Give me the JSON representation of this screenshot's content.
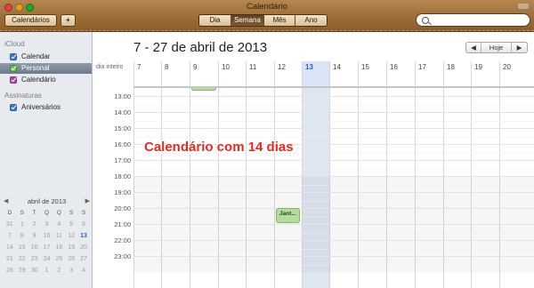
{
  "window": {
    "title": "Calendário"
  },
  "toolbar": {
    "calendars_label": "Calendários",
    "add_label": "+",
    "views": [
      "Dia",
      "Semana",
      "Mês",
      "Ano"
    ],
    "active_view": "Semana",
    "search_placeholder": ""
  },
  "sidebar": {
    "icloud_header": "iCloud",
    "icloud_items": [
      {
        "label": "Calendar",
        "color": "#3a78c6",
        "checked": true
      },
      {
        "label": "Personal",
        "color": "#6cbf4f",
        "checked": true,
        "selected": true
      },
      {
        "label": "Calendário",
        "color": "#b147a5",
        "checked": true
      }
    ],
    "subs_header": "Assinaturas",
    "subs_items": [
      {
        "label": "Aniversários",
        "color": "#3a78c6",
        "checked": true
      }
    ]
  },
  "mini_calendar": {
    "title": "abril de 2013",
    "prev": "◀",
    "next": "▶",
    "day_headers": [
      "D",
      "S",
      "T",
      "Q",
      "Q",
      "S",
      "S"
    ],
    "rows": [
      [
        "31",
        "1",
        "2",
        "3",
        "4",
        "5",
        "6"
      ],
      [
        "7",
        "8",
        "9",
        "10",
        "11",
        "12",
        "13"
      ],
      [
        "14",
        "15",
        "16",
        "17",
        "18",
        "19",
        "20"
      ],
      [
        "21",
        "22",
        "23",
        "24",
        "25",
        "26",
        "27"
      ],
      [
        "28",
        "29",
        "30",
        "1",
        "2",
        "3",
        "4"
      ]
    ],
    "today": "13"
  },
  "main": {
    "range_title": "7 - 27 de abril de 2013",
    "nav_prev": "◀",
    "nav_today": "Hoje",
    "nav_next": "▶",
    "allday_label": "dia inteiro",
    "days": [
      "7",
      "8",
      "9",
      "10",
      "11",
      "12",
      "13",
      "14",
      "15",
      "16",
      "17",
      "18",
      "19",
      "20"
    ],
    "today_index": 6,
    "hours": [
      "13:00",
      "14:00",
      "15:00",
      "16:00",
      "17:00",
      "18:00",
      "19:00",
      "20:00",
      "21:00",
      "22:00",
      "23:00"
    ],
    "events": [
      {
        "day_index": 2,
        "title": "",
        "color": "#b5dba0"
      },
      {
        "day_index": 5,
        "title": "Jant...",
        "color": "#b5dba0",
        "time": "20:00"
      }
    ]
  },
  "annotation": "Calendário com 14 dias"
}
